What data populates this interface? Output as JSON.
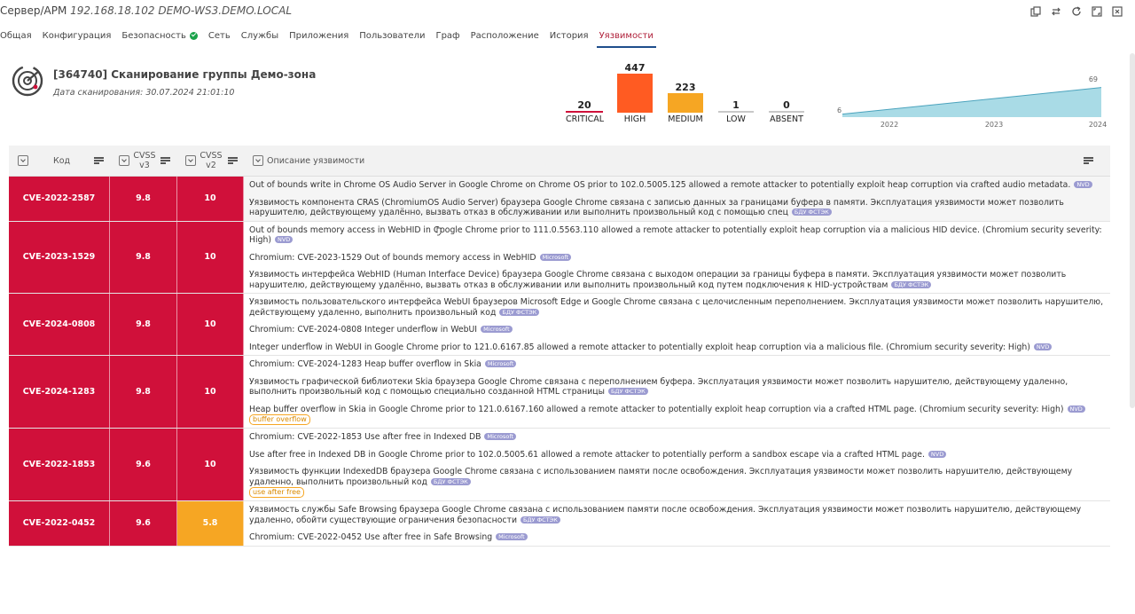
{
  "window": {
    "title_prefix": "Сервер/АРМ",
    "title_host": "192.168.18.102 DEMO-WS3.DEMO.LOCAL",
    "icons": [
      "copy-icon",
      "swap-icon",
      "refresh-icon",
      "expand-icon",
      "close-icon"
    ]
  },
  "tabs": [
    {
      "label": "Общая"
    },
    {
      "label": "Конфигурация"
    },
    {
      "label": "Безопасность",
      "status": "ok"
    },
    {
      "label": "Сеть"
    },
    {
      "label": "Службы"
    },
    {
      "label": "Приложения"
    },
    {
      "label": "Пользователи"
    },
    {
      "label": "Граф"
    },
    {
      "label": "Расположение"
    },
    {
      "label": "История"
    },
    {
      "label": "Уязвимости",
      "active": true
    }
  ],
  "scan": {
    "title": "[364740] Сканирование группы Демо-зона",
    "date": "Дата сканирования: 30.07.2024 21:01:10"
  },
  "severity": [
    {
      "count": "20",
      "label": "CRITICAL",
      "color": "#d0103a"
    },
    {
      "count": "447",
      "label": "HIGH",
      "color": "#ff5b22"
    },
    {
      "count": "223",
      "label": "MEDIUM",
      "color": "#f6a623"
    },
    {
      "count": "1",
      "label": "LOW",
      "color": "#c8c8c8"
    },
    {
      "count": "0",
      "label": "ABSENT",
      "color": "#c8c8c8"
    }
  ],
  "trend": {
    "start_label": "6",
    "end_label": "69",
    "years": [
      "2022",
      "2023",
      "2024"
    ],
    "values": [
      6,
      69
    ],
    "fill": "#a9dbe6",
    "stroke": "#4ba3bd"
  },
  "table": {
    "headers": {
      "code": "Код",
      "cvss3": "CVSS v3",
      "cvss2": "CVSS v2",
      "desc": "Описание уязвимости"
    },
    "rows": [
      {
        "code": "CVE-2022-2587",
        "v3": "9.8",
        "v2": "10",
        "v2color": "red",
        "desc": [
          {
            "text": "Out of bounds write in Chrome OS Audio Server in Google Chrome on Chrome OS prior to 102.0.5005.125 allowed a remote attacker to potentially exploit heap corruption via crafted audio metadata.",
            "badge": "NVD"
          },
          {
            "text": "Уязвимость компонента CRAS (ChromiumOS Audio Server) браузера Google Chrome связана с записью данных за границами буфера в памяти. Эксплуатация уязвимости может позволить нарушителю, действующему удалённо, вызвать отказ в обслуживании или выполнить произвольный код с помощью спец",
            "badge": "БДУ ФСТЭК"
          }
        ]
      },
      {
        "code": "CVE-2023-1529",
        "v3": "9.8",
        "v2": "10",
        "v2color": "red",
        "desc": [
          {
            "text": "Out of bounds memory access in WebHID in Google Chrome prior to 111.0.5563.110 allowed a remote attacker to potentially exploit heap corruption via a malicious HID device. (Chromium security severity: High)",
            "badge": "NVD"
          },
          {
            "text": "Chromium: CVE-2023-1529 Out of bounds memory access in WebHID",
            "badge": "Microsoft"
          },
          {
            "text": "Уязвимость интерфейса WebHID (Human Interface Device) браузера Google Chrome связана с выходом операции за границы буфера в памяти. Эксплуатация уязвимости может позволить нарушителю, действующему удалённо, вызвать отказ в обслуживании или выполнить произвольный код путем подключения к HID-устройствам",
            "badge": "БДУ ФСТЭК"
          }
        ]
      },
      {
        "code": "CVE-2024-0808",
        "v3": "9.8",
        "v2": "10",
        "v2color": "red",
        "desc": [
          {
            "text": "Уязвимость пользовательского интерфейса WebUI браузеров Microsoft Edge и Google Chrome связана с целочисленным переполнением. Эксплуатация уязвимости может позволить нарушителю, действующему удаленно, выполнить произвольный код",
            "badge": "БДУ ФСТЭК"
          },
          {
            "text": "Chromium: CVE-2024-0808 Integer underflow in WebUI",
            "badge": "Microsoft"
          },
          {
            "text": "Integer underflow in WebUI in Google Chrome prior to 121.0.6167.85 allowed a remote attacker to potentially exploit heap corruption via a malicious file. (Chromium security severity: High)",
            "badge": "NVD"
          }
        ]
      },
      {
        "code": "CVE-2024-1283",
        "v3": "9.8",
        "v2": "10",
        "v2color": "red",
        "desc": [
          {
            "text": "Chromium: CVE-2024-1283 Heap buffer overflow in Skia",
            "badge": "Microsoft"
          },
          {
            "text": "Уязвимость графической библиотеки Skia браузера Google Chrome связана с переполнением буфера. Эксплуатация уязвимости может позволить нарушителю, действующему удаленно, выполнить произвольный код с помощью специально созданной HTML страницы",
            "badge": "БДУ ФСТЭК"
          },
          {
            "text": "Heap buffer overflow in Skia in Google Chrome prior to 121.0.6167.160 allowed a remote attacker to potentially exploit heap corruption via a crafted HTML page. (Chromium security severity: High)",
            "badge": "NVD",
            "tag": "buffer overflow"
          }
        ]
      },
      {
        "code": "CVE-2022-1853",
        "v3": "9.6",
        "v2": "10",
        "v2color": "red",
        "desc": [
          {
            "text": "Chromium: CVE-2022-1853 Use after free in Indexed DB",
            "badge": "Microsoft"
          },
          {
            "text": "Use after free in Indexed DB in Google Chrome prior to 102.0.5005.61 allowed a remote attacker to potentially perform a sandbox escape via a crafted HTML page.",
            "badge": "NVD"
          },
          {
            "text": "Уязвимость функции IndexedDB браузера Google Chrome связана с использованием памяти после освобождения. Эксплуатация уязвимости может позволить нарушителю, действующему удаленно, выполнить произвольный код",
            "badge": "БДУ ФСТЭК",
            "tag": "use after free"
          }
        ]
      },
      {
        "code": "CVE-2022-0452",
        "v3": "9.6",
        "v2": "5.8",
        "v2color": "org",
        "desc": [
          {
            "text": "Уязвимость службы Safe Browsing браузера Google Chrome связана с использованием памяти после освобождения. Эксплуатация уязвимости может позволить нарушителю, действующему удаленно, обойти существующие ограничения безопасности",
            "badge": "БДУ ФСТЭК"
          },
          {
            "text": "Chromium: CVE-2022-0452 Use after free in Safe Browsing",
            "badge": "Microsoft"
          }
        ]
      }
    ]
  }
}
